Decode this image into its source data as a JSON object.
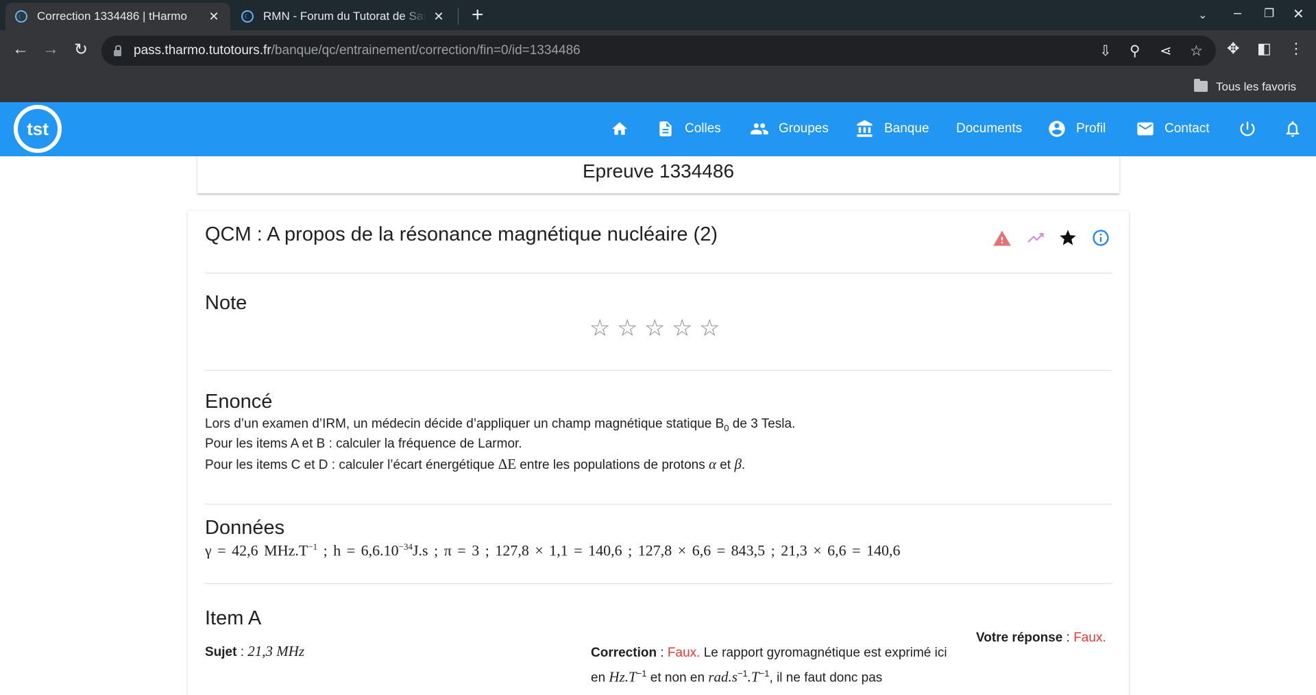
{
  "browser": {
    "tabs": [
      {
        "title": "Correction 1334486 | tHarmo",
        "active": true
      },
      {
        "title": "RMN - Forum du Tutorat de Santé",
        "active": false
      }
    ],
    "url_host": "pass.tharmo.tutotours.fr",
    "url_path": "/banque/qc/entrainement/correction/fin=0/id=1334486",
    "bookmarks_label": "Tous les favoris"
  },
  "appbar": {
    "logo_text": "tst",
    "nav": [
      {
        "label": "",
        "icon": "home-icon"
      },
      {
        "label": "Colles",
        "icon": "document-icon"
      },
      {
        "label": "Groupes",
        "icon": "group-icon"
      },
      {
        "label": "Banque",
        "icon": "bank-icon"
      },
      {
        "label": "Documents",
        "icon": ""
      },
      {
        "label": "Profil",
        "icon": "account-icon"
      },
      {
        "label": "Contact",
        "icon": "mail-icon"
      },
      {
        "label": "",
        "icon": "power-icon"
      },
      {
        "label": "",
        "icon": "bell-icon"
      }
    ]
  },
  "epreuve": {
    "title": "Epreuve 1334486"
  },
  "qcm": {
    "title": "QCM : A propos de la résonance magnétique nucléaire (2)",
    "icons": {
      "warning_color": "#e57373",
      "trend_color": "#ce93d8",
      "star_color": "#111111",
      "info_color": "#1e88e5"
    }
  },
  "note": {
    "title": "Note",
    "rating": 0,
    "max": 5
  },
  "enonce": {
    "title": "Enoncé",
    "line1_a": "Lors d’un examen d’IRM, un médecin décide d’appliquer un champ magnétique statique B",
    "line1_sub": "0",
    "line1_b": " de 3 Tesla.",
    "line2": "Pour les items A et B : calculer la fréquence de Larmor.",
    "line3_a": "Pour les items C et D : calculer l’écart énergétique ",
    "line3_delta": "ΔE",
    "line3_b": " entre les populations de protons ",
    "line3_alpha": "α",
    "line3_et": " et ",
    "line3_beta": "β",
    "line3_end": "."
  },
  "donnees": {
    "title": "Données",
    "f1": "γ = 42,6 MHz.T",
    "f1_sup": "−1",
    "f2": " ; h = 6,6.10",
    "f2_sup": "−34",
    "f3": "J.s ; π = 3 ; 127,8 × 1,1 = 140,6 ; 127,8 × 6,6 = 843,5 ; 21,3 × 6,6 = 140,6"
  },
  "item_a": {
    "title": "Item A",
    "sujet_label": "Sujet",
    "sujet_sep": " : ",
    "sujet_value": "21,3 MHz",
    "correction_label": "Correction",
    "correction_sep": " : ",
    "correction_verdict": "Faux.",
    "correction_text1": " Le rapport gyromagnétique est exprimé ici",
    "correction_line2_a": "en ",
    "correction_unit1": "Hz.T",
    "correction_unit1_sup": "−1",
    "correction_line2_b": " et non en ",
    "correction_unit2": "rad.s",
    "correction_unit2_sup": "−1",
    "correction_unit2_c": ".T",
    "correction_unit2_sup2": "−1",
    "correction_line2_c": ", il ne faut donc pas",
    "reponse_label": "Votre réponse",
    "reponse_sep": " : ",
    "reponse_value": "Faux."
  }
}
